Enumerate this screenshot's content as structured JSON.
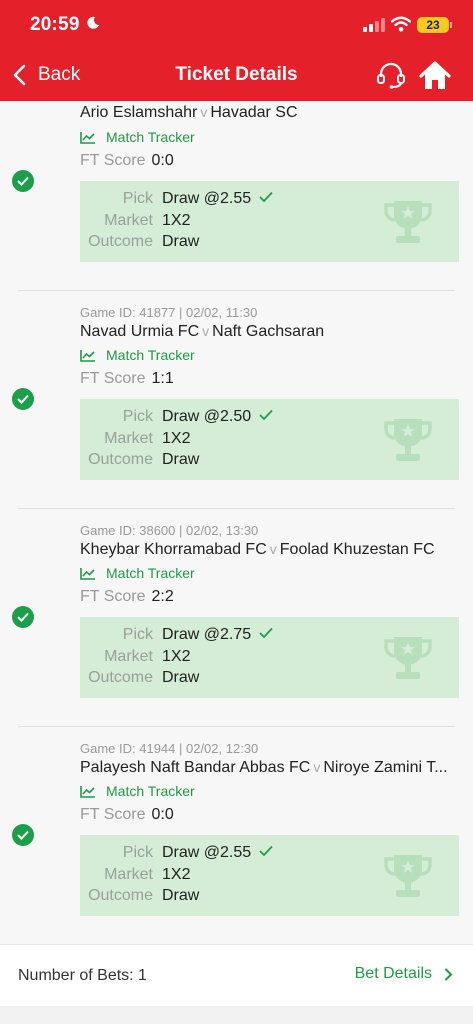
{
  "status_bar": {
    "time": "20:59",
    "battery": "23"
  },
  "nav": {
    "back_label": "Back",
    "title": "Ticket Details"
  },
  "colors": {
    "brand": "#e4202a",
    "success": "#1ba049",
    "pick_box": "#d5ecd6",
    "battery": "#f2cc1f"
  },
  "bets": [
    {
      "game_id": "",
      "home": "Ario Eslamshahr",
      "vs": "v",
      "away": "Havadar SC",
      "tracker_label": "Match Tracker",
      "score_label": "FT Score",
      "score": "0:0",
      "pick_label": "Pick",
      "pick": "Draw @2.55",
      "market_label": "Market",
      "market": "1X2",
      "outcome_label": "Outcome",
      "outcome": "Draw",
      "status_icon": "check-circle-icon"
    },
    {
      "game_id": "Game ID: 41877 | 02/02, 11:30",
      "home": "Navad Urmia FC",
      "vs": "v",
      "away": "Naft Gachsaran",
      "tracker_label": "Match Tracker",
      "score_label": "FT Score",
      "score": "1:1",
      "pick_label": "Pick",
      "pick": "Draw @2.50",
      "market_label": "Market",
      "market": "1X2",
      "outcome_label": "Outcome",
      "outcome": "Draw",
      "status_icon": "check-circle-icon"
    },
    {
      "game_id": "Game ID: 38600 | 02/02, 13:30",
      "home": "Kheybar Khorramabad FC",
      "vs": "v",
      "away": "Foolad Khuzestan FC",
      "tracker_label": "Match Tracker",
      "score_label": "FT Score",
      "score": "2:2",
      "pick_label": "Pick",
      "pick": "Draw @2.75",
      "market_label": "Market",
      "market": "1X2",
      "outcome_label": "Outcome",
      "outcome": "Draw",
      "status_icon": "check-circle-icon"
    },
    {
      "game_id": "Game ID: 41944 | 02/02, 12:30",
      "home": "Palayesh Naft Bandar Abbas FC",
      "vs": "v",
      "away": "Niroye Zamini T...",
      "tracker_label": "Match Tracker",
      "score_label": "FT Score",
      "score": "0:0",
      "pick_label": "Pick",
      "pick": "Draw @2.55",
      "market_label": "Market",
      "market": "1X2",
      "outcome_label": "Outcome",
      "outcome": "Draw",
      "status_icon": "check-circle-icon"
    }
  ],
  "footer": {
    "bets_count": "Number of Bets: 1",
    "details_label": "Bet Details"
  }
}
